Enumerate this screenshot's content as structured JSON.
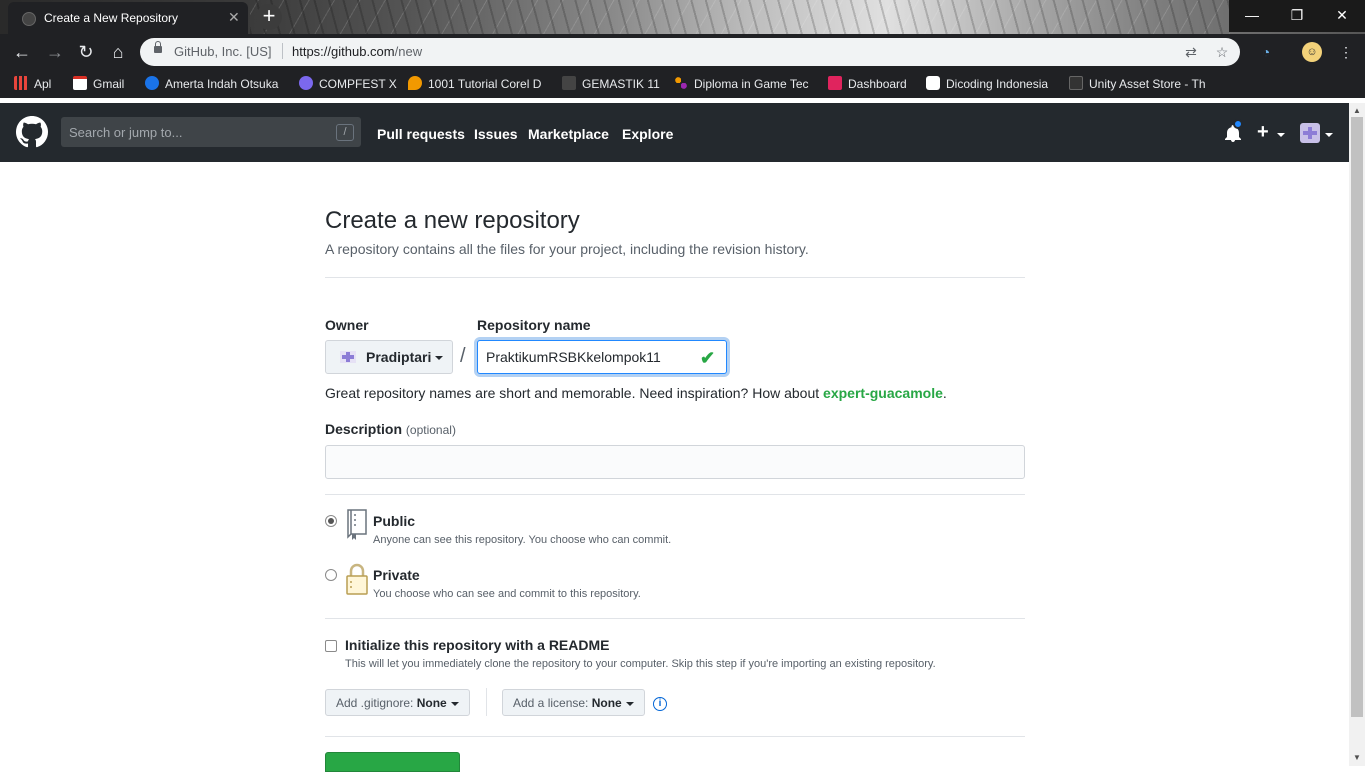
{
  "browser": {
    "tab_title": "Create a New Repository",
    "new_tab_symbol": "+",
    "window_controls": {
      "minimize": "—",
      "restore": "❐",
      "close": "✕"
    },
    "toolbar": {
      "back": "←",
      "forward": "→",
      "reload": "↻",
      "home": "⌂"
    },
    "omnibox": {
      "site_identity": "GitHub, Inc. [US]",
      "url_host": "https://github.com",
      "url_path": "/new"
    },
    "bookmarks": [
      {
        "label": "Apl",
        "icon": "apps-grid-icon",
        "color": "#e8453c"
      },
      {
        "label": "Gmail",
        "icon": "gmail-icon",
        "color": "#d93025"
      },
      {
        "label": "Amerta Indah Otsuka",
        "icon": "bookmark-icon",
        "color": "#1a73e8"
      },
      {
        "label": "COMPFEST X",
        "icon": "compfest-icon",
        "color": "#7b68ee"
      },
      {
        "label": "1001 Tutorial Corel D",
        "icon": "location-pin-icon",
        "color": "#f29900"
      },
      {
        "label": "GEMASTIK 11",
        "icon": "gemastik-icon",
        "color": "#444444"
      },
      {
        "label": "Diploma in Game Tec",
        "icon": "people-icon",
        "color": "#9c27b0"
      },
      {
        "label": "Dashboard",
        "icon": "dashboard-icon",
        "color": "#e0245e"
      },
      {
        "label": "Dicoding Indonesia",
        "icon": "dicoding-icon",
        "color": "#ffffff"
      },
      {
        "label": "Unity Asset Store - Th",
        "icon": "unity-icon",
        "color": "#333333"
      }
    ]
  },
  "github": {
    "search_placeholder": "Search or jump to...",
    "search_shortcut": "/",
    "nav": [
      "Pull requests",
      "Issues",
      "Marketplace",
      "Explore"
    ]
  },
  "page": {
    "title": "Create a new repository",
    "subtitle": "A repository contains all the files for your project, including the revision history.",
    "owner_label": "Owner",
    "owner_value": "Pradiptari",
    "slash": "/",
    "repo_name_label": "Repository name",
    "repo_name_value": "PraktikumRSBKkelompok11",
    "hint_text": "Great repository names are short and memorable. Need inspiration? How about ",
    "hint_suggestion": "expert-guacamole",
    "hint_end": ".",
    "description_label": "Description",
    "description_optional": "(optional)",
    "description_value": "",
    "visibility": {
      "selected": "public",
      "public_title": "Public",
      "public_note": "Anyone can see this repository. You choose who can commit.",
      "private_title": "Private",
      "private_note": "You choose who can see and commit to this repository."
    },
    "readme": {
      "checked": false,
      "title": "Initialize this repository with a README",
      "note": "This will let you immediately clone the repository to your computer. Skip this step if you're importing an existing repository."
    },
    "gitignore": {
      "prefix": "Add .gitignore: ",
      "value": "None"
    },
    "license": {
      "prefix": "Add a license: ",
      "value": "None"
    },
    "info_symbol": "i",
    "colors": {
      "accent_green": "#28a745",
      "header_bg": "#24292e",
      "focus_blue": "#2188ff"
    }
  }
}
